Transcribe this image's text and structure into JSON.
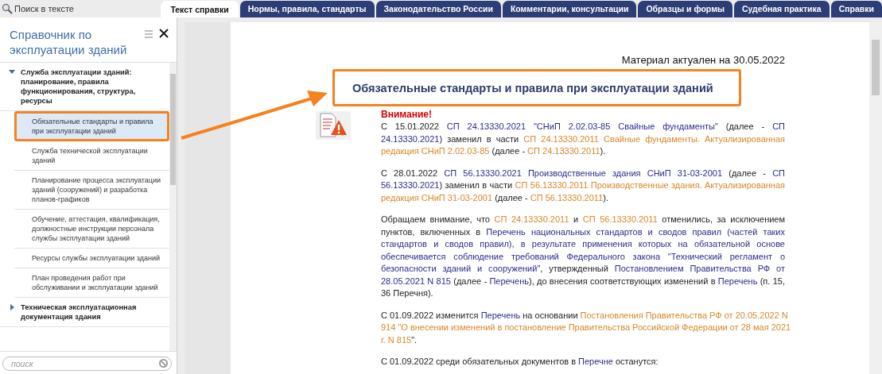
{
  "search_bar": {
    "label": "Поиск в тексте"
  },
  "tabs": [
    {
      "label": "Текст справки",
      "selected": true
    },
    {
      "label": "Нормы, правила, стандарты",
      "selected": false
    },
    {
      "label": "Законодательство России",
      "selected": false
    },
    {
      "label": "Комментарии, консультации",
      "selected": false
    },
    {
      "label": "Образцы и формы",
      "selected": false
    },
    {
      "label": "Судебная практика",
      "selected": false
    },
    {
      "label": "Справки",
      "selected": false
    }
  ],
  "sidebar": {
    "title": "Справочник по эксплуатации зданий",
    "search": {
      "placeholder": "поиск"
    },
    "tree": [
      {
        "label": "Служба эксплуатации зданий: планирование, правила функционирования, структура, ресурсы",
        "expanded": true,
        "children": [
          {
            "label": "Обязательные стандарты и правила при эксплуатации зданий",
            "selected": true
          },
          {
            "label": "Служба технической эксплуатации зданий",
            "selected": false
          },
          {
            "label": "Планирование процесса эксплуатации зданий (сооружений) и разработка планов-графиков",
            "selected": false
          },
          {
            "label": "Обучение, аттестация, квалификация, должностные инструкции персонала службы эксплуатации зданий",
            "selected": false
          },
          {
            "label": "Ресурсы службы эксплуатации зданий",
            "selected": false
          },
          {
            "label": "План проведения работ при обслуживании и эксплуатации зданий",
            "selected": false
          }
        ]
      },
      {
        "label": "Техническая эксплуатационная документация здания",
        "expanded": false
      }
    ]
  },
  "document": {
    "date_note": "Материал актуален на 30.05.2022",
    "title": "Обязательные стандарты и правила при эксплуатации зданий",
    "warning_heading": "Внимание!",
    "paragraphs": [
      {
        "lines": [
          [
            {
              "kind": "text",
              "text": "С 15.01.2022"
            },
            {
              "kind": "link",
              "text": "СП 24.13330.2021 \"СНиП 2.02.03-85 Свайные фундаменты\""
            },
            {
              "kind": "text",
              "text": "(далее -"
            },
            {
              "kind": "link",
              "text": "СП"
            }
          ],
          [
            {
              "kind": "link",
              "text": "24.13330.2021"
            },
            {
              "kind": "text",
              "text": ") заменил в части"
            },
            {
              "kind": "old_link",
              "text": "СП 24.13330.2011 Свайные фундаменты. Актуализированная"
            }
          ],
          [
            {
              "kind": "old_link",
              "text": "редакция СНиП 2.02.03-85"
            },
            {
              "kind": "text",
              "text": "(далее -"
            },
            {
              "kind": "old_link",
              "text": "СП 24.13330.2011"
            },
            {
              "kind": "text",
              "text": ")."
            }
          ]
        ]
      },
      {
        "lines": [
          [
            {
              "kind": "text",
              "text": "С 28.01.2022"
            },
            {
              "kind": "link",
              "text": "СП 56.13330.2021 Производственные здания СНиП 31-03-2001"
            },
            {
              "kind": "text",
              "text": "(далее -"
            },
            {
              "kind": "link",
              "text": "СП"
            }
          ],
          [
            {
              "kind": "link",
              "text": "56.13330.2021"
            },
            {
              "kind": "text",
              "text": ") заменил в части"
            },
            {
              "kind": "old_link",
              "text": "СП 56.13330.2011 Производственные здания. Актуализированная"
            }
          ],
          [
            {
              "kind": "old_link",
              "text": "редакция СНиП 31-03-2001"
            },
            {
              "kind": "text",
              "text": "(далее -"
            },
            {
              "kind": "old_link",
              "text": "СП 56.13330.2011"
            },
            {
              "kind": "text",
              "text": ")."
            }
          ]
        ]
      },
      {
        "lines": [
          [
            {
              "kind": "text",
              "text": "Обращаем внимание, что"
            },
            {
              "kind": "old_link",
              "text": "СП 24.13330.2011"
            },
            {
              "kind": "text",
              "text": "и"
            },
            {
              "kind": "old_link",
              "text": "СП 56.13330.2011"
            },
            {
              "kind": "text",
              "text": "отменились, за исключением"
            }
          ],
          [
            {
              "kind": "text",
              "text": "пунктов, включенных в"
            },
            {
              "kind": "link",
              "text": "Перечень национальных стандартов и сводов правил (частей таких"
            }
          ],
          [
            {
              "kind": "link",
              "text": "стандартов и сводов правил), в результате применения которых на обязательной основе"
            }
          ],
          [
            {
              "kind": "link",
              "text": "обеспечивается соблюдение требований Федерального закона \"Технический регламент о"
            }
          ],
          [
            {
              "kind": "link",
              "text": "безопасности зданий и сооружений\""
            },
            {
              "kind": "text",
              "text": ", утвержденный"
            },
            {
              "kind": "link",
              "text": "Постановлением Правительства РФ от"
            }
          ],
          [
            {
              "kind": "link",
              "text": "28.05.2021 N 815"
            },
            {
              "kind": "text",
              "text": "(далее -"
            },
            {
              "kind": "link",
              "text": "Перечень"
            },
            {
              "kind": "text",
              "text": "), до внесения соответствующих изменений в"
            },
            {
              "kind": "link",
              "text": "Перечень"
            },
            {
              "kind": "text",
              "text": "(п. 15,"
            }
          ],
          [
            {
              "kind": "text",
              "text": "36 Перечня)."
            }
          ]
        ]
      },
      {
        "lines": [
          [
            {
              "kind": "text",
              "text": "С 01.09.2022 изменится"
            },
            {
              "kind": "link",
              "text": "Перечень"
            },
            {
              "kind": "text",
              "text": "на основании"
            },
            {
              "kind": "old_link",
              "text": "Постановления Правительства РФ от 20.05.2022 N"
            }
          ],
          [
            {
              "kind": "old_link",
              "text": "914 \"О внесении изменений в постановление Правительства Российской Федерации от 28 мая 2021"
            }
          ],
          [
            {
              "kind": "old_link",
              "text": "г. N 815"
            },
            {
              "kind": "text",
              "text": "\"."
            }
          ]
        ]
      },
      {
        "lines": [
          [
            {
              "kind": "text",
              "text": "С 01.09.2022 среди обязательных документов в"
            },
            {
              "kind": "link",
              "text": "Перечне"
            },
            {
              "kind": "text",
              "text": "останутся:"
            }
          ]
        ]
      }
    ]
  }
}
